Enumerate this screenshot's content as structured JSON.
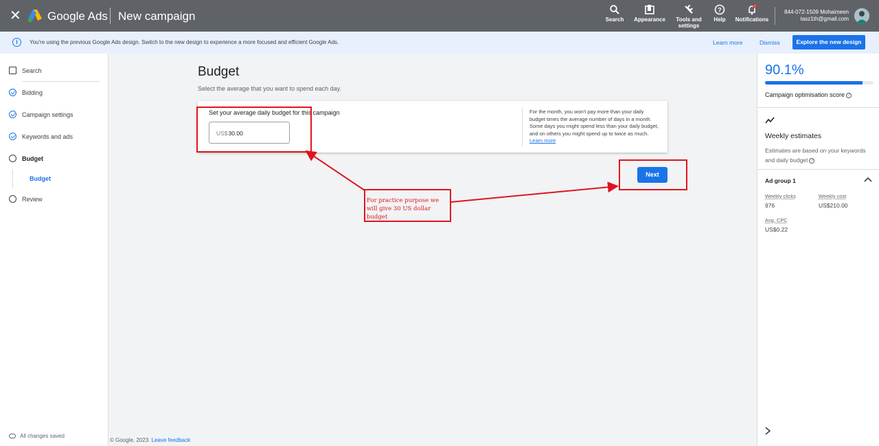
{
  "topbar": {
    "close_icon": "close-icon",
    "brand": "Google Ads",
    "page_name": "New campaign",
    "tools": [
      {
        "label": "Search",
        "icon": "search-icon"
      },
      {
        "label": "Appearance",
        "icon": "appearance-icon"
      },
      {
        "label": "Tools and settings",
        "icon": "wrench-icon"
      },
      {
        "label": "Help",
        "icon": "help-icon"
      },
      {
        "label": "Notifications",
        "icon": "bell-icon",
        "badge": "!"
      }
    ],
    "account_id": "844-072-1509 Mohaimeen",
    "account_email": "tasz1th@gmail.com"
  },
  "notice": {
    "message": "You're using the previous Google Ads design. Switch to the new design to experience a more focused and efficient Google Ads.",
    "learn_more": "Learn more",
    "dismiss": "Dismiss",
    "explore": "Explore the new design"
  },
  "leftnav": {
    "items": [
      {
        "label": "Search",
        "state": "type"
      },
      {
        "label": "Bidding",
        "state": "done"
      },
      {
        "label": "Campaign settings",
        "state": "done"
      },
      {
        "label": "Keywords and ads",
        "state": "done"
      },
      {
        "label": "Budget",
        "state": "current"
      },
      {
        "label": "Review",
        "state": "todo"
      }
    ],
    "sub_item": "Budget",
    "saved": "All changes saved"
  },
  "main": {
    "title": "Budget",
    "subtitle": "Select the average that you want to spend each day.",
    "question": "Set your average daily budget for this campaign",
    "currency": "US$",
    "budget_value": "30.00",
    "help_text": "For the month, you won't pay more than your daily budget times the average number of days in a month. Some days you might spend less than your daily budget, and on others you might spend up to twice as much.",
    "help_link": "Learn more",
    "next": "Next"
  },
  "annotation": {
    "text": "For practice purpose we will give 30 US dollar budget",
    "color": "#e0141e"
  },
  "footer": {
    "copyright": "© Google, 2023.",
    "feedback": "Leave feedback"
  },
  "rightpanel": {
    "score": "90.1%",
    "score_fraction": 0.901,
    "score_label": "Campaign optimisation score",
    "weekly_title": "Weekly estimates",
    "weekly_desc": "Estimates are based on your keywords and daily budget",
    "ad_group": "Ad group 1",
    "metrics": [
      {
        "label": "Weekly clicks",
        "value": "976"
      },
      {
        "label": "Weekly cost",
        "value": "US$210.00"
      },
      {
        "label": "Avg. CPC",
        "value": "US$0.22"
      }
    ]
  },
  "colors": {
    "accent": "#1a73e8",
    "topbar": "#5f6368",
    "annotation": "#e0141e"
  }
}
